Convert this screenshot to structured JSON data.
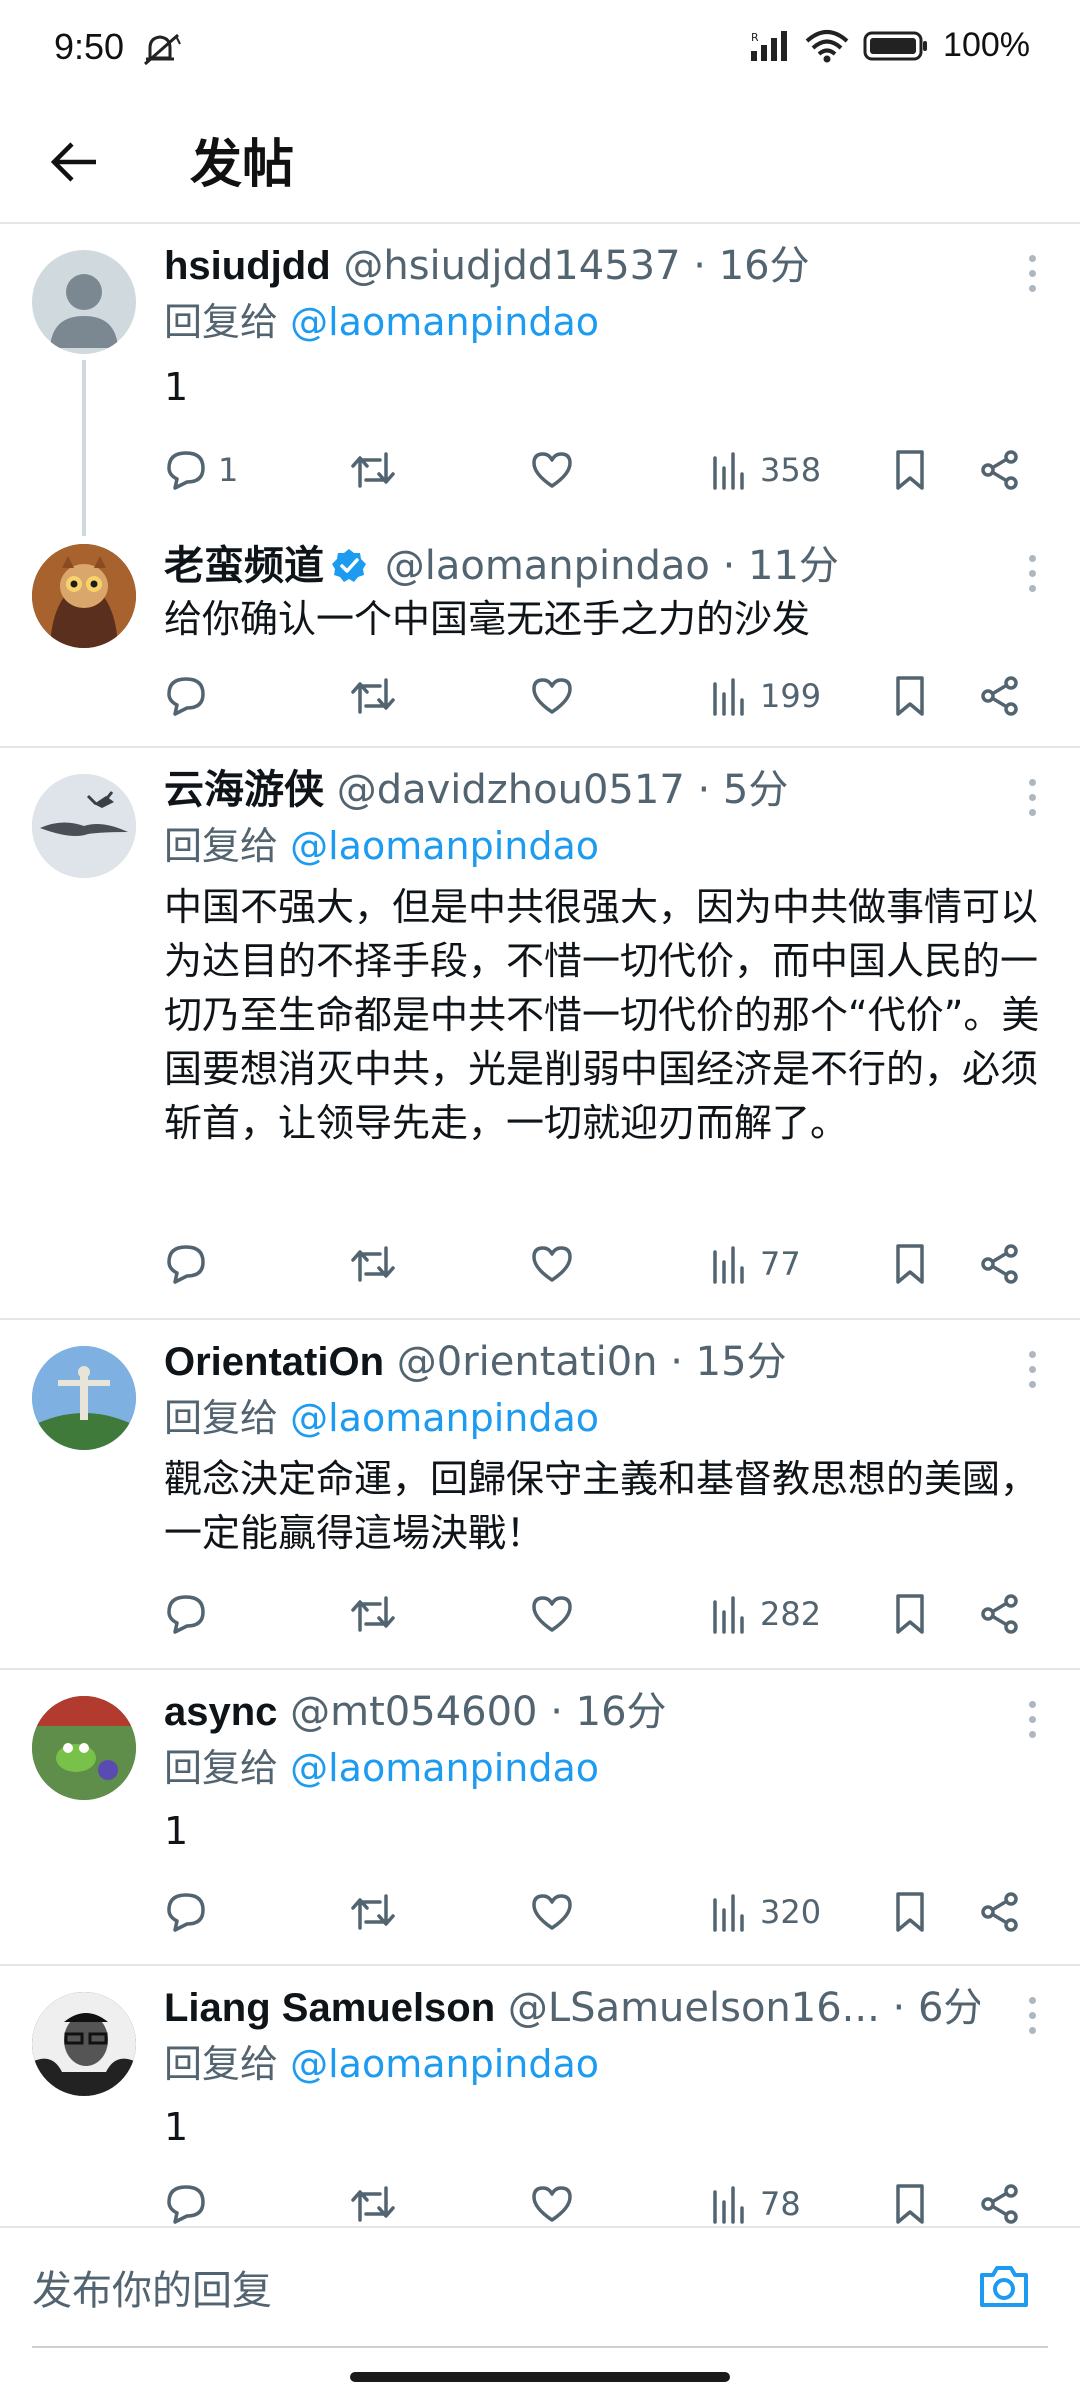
{
  "status_bar": {
    "time": "9:50",
    "battery": "100%"
  },
  "header": {
    "title": "发帖"
  },
  "tweets": [
    {
      "name": "hsiudjdd",
      "handle": "@hsiudjdd14537",
      "time": "· 16分",
      "reply_prefix": "回复给",
      "reply_to": "@laomanpindao",
      "text": "1",
      "replies": "1",
      "views": "358"
    },
    {
      "name": "老蛮频道",
      "handle": "@laomanpindao",
      "time": "· 11分",
      "text": "给你确认一个中国毫无还手之力的沙发",
      "views": "199"
    },
    {
      "name": "云海游侠",
      "handle": "@davidzhou0517",
      "time": "· 5分",
      "reply_prefix": "回复给",
      "reply_to": "@laomanpindao",
      "text": "中国不强大，但是中共很强大，因为中共做事情可以为达目的不择手段，不惜一切代价，而中国人民的一切乃至生命都是中共不惜一切代价的那个“代价”。美国要想消灭中共，光是削弱中国经济是不行的，必须斩首，让领导先走，一切就迎刃而解了。",
      "views": "77"
    },
    {
      "name": "OrientatiOn",
      "handle": "@0rientati0n",
      "time": "· 15分",
      "reply_prefix": "回复给",
      "reply_to": "@laomanpindao",
      "text": "觀念決定命運，回歸保守主義和基督教思想的美國，一定能贏得這場決戰！",
      "views": "282"
    },
    {
      "name": "async",
      "handle": "@mt054600",
      "time": "· 16分",
      "reply_prefix": "回复给",
      "reply_to": "@laomanpindao",
      "text": "1",
      "views": "320"
    },
    {
      "name": "Liang Samuelson",
      "handle": "@LSamuelson16...",
      "time": "· 6分",
      "reply_prefix": "回复给",
      "reply_to": "@laomanpindao",
      "text": "1",
      "views": "78"
    }
  ],
  "compose": {
    "placeholder": "发布你的回复"
  },
  "colors": {
    "accent": "#1d9bf0",
    "muted": "#536471",
    "divider": "#e6e6e6"
  }
}
